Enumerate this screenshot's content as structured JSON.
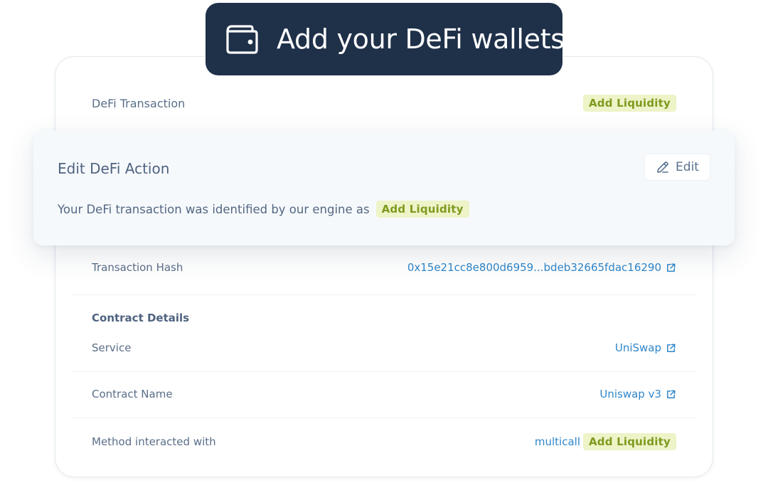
{
  "banner": {
    "title": "Add your DeFi wallets",
    "icon": "wallet-icon"
  },
  "card": {
    "defi_transaction": {
      "label": "DeFi Transaction",
      "badge": "Add Liquidity"
    },
    "transaction_hash": {
      "label": "Transaction Hash",
      "value": "0x15e21cc8e800d6959...bdeb32665fdac16290"
    },
    "contract_details": {
      "title": "Contract Details",
      "service": {
        "label": "Service",
        "value": "UniSwap"
      },
      "contract_name": {
        "label": "Contract Name",
        "value": "Uniswap v3"
      },
      "method": {
        "label": "Method interacted with",
        "value": "multicall",
        "badge": "Add Liquidity"
      }
    }
  },
  "edit_panel": {
    "title": "Edit DeFi Action",
    "edit_label": "Edit",
    "description": "Your DeFi transaction was identified by our engine as",
    "badge": "Add Liquidity"
  },
  "colors": {
    "banner_bg": "#1f3049",
    "link": "#2f86c9",
    "badge_bg": "#eef3c8",
    "badge_text": "#7e9a1e"
  }
}
